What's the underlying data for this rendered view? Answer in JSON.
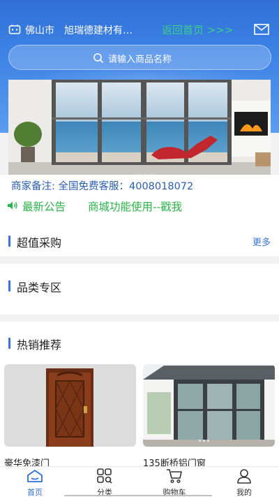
{
  "topbar": {
    "city": "佛山市",
    "shop_name": "旭瑞德建材有…",
    "home_link": "返回首页 >>>"
  },
  "search": {
    "placeholder": "请输入商品名称"
  },
  "notes": {
    "merchant_note": "商家备注: 全国免费客服：4008018072",
    "notice_label": "最新公告",
    "notice_text": "商城功能使用--戳我"
  },
  "sections": {
    "deals": {
      "title": "超值采购",
      "more": "更多"
    },
    "categories": {
      "title": "品类专区"
    },
    "hot": {
      "title": "热销推荐"
    }
  },
  "products": [
    {
      "name": "豪华免漆门"
    },
    {
      "name": "135断桥铝门窗"
    }
  ],
  "tabbar": {
    "items": [
      {
        "label": "首页",
        "icon": "home-icon",
        "active": true
      },
      {
        "label": "分类",
        "icon": "category-icon",
        "active": false
      },
      {
        "label": "购物车",
        "icon": "cart-icon",
        "active": false
      },
      {
        "label": "我的",
        "icon": "user-icon",
        "active": false
      }
    ]
  },
  "colors": {
    "brand_blue": "#2f6fd6",
    "notice_green": "#2cb34a",
    "link_green": "#3ad08c",
    "note_blue": "#2a5db0"
  }
}
